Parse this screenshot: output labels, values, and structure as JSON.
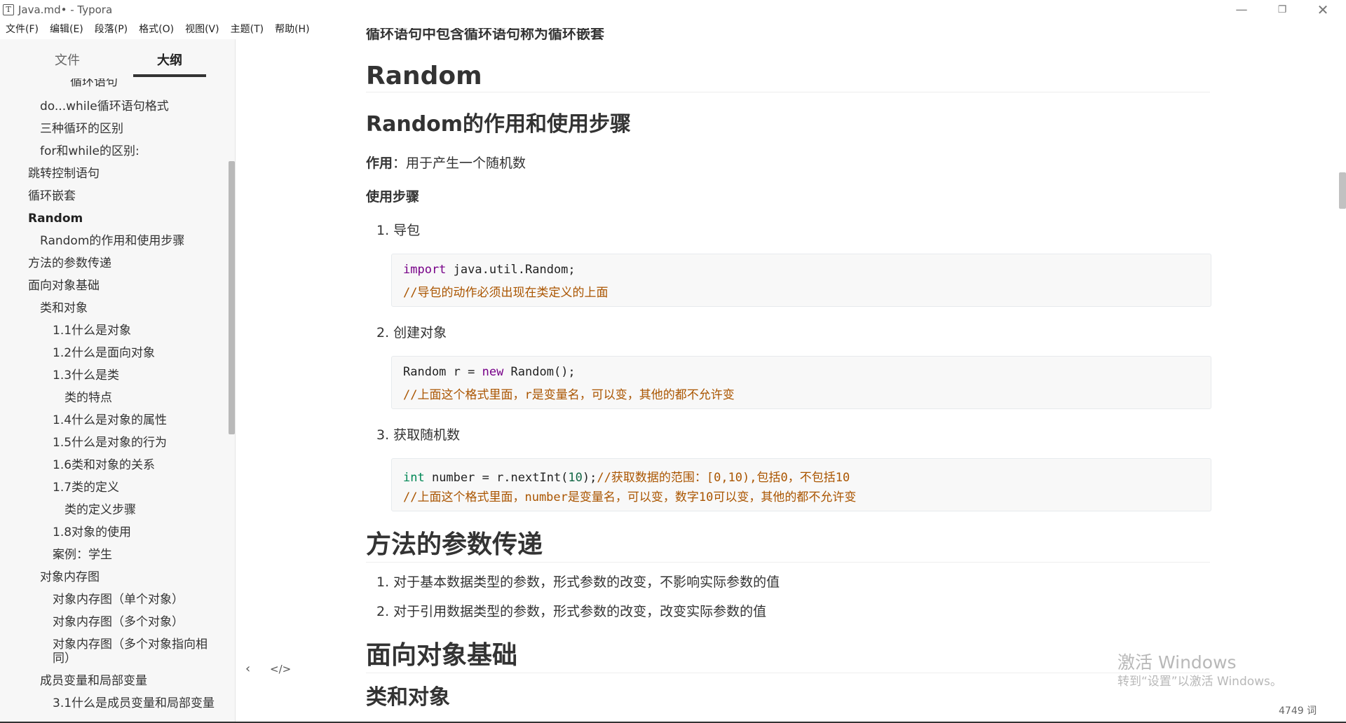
{
  "window": {
    "title": "Java.md• - Typora",
    "app_icon": "T",
    "controls": [
      "—",
      "❐",
      "✕"
    ]
  },
  "menu": [
    "文件(F)",
    "编辑(E)",
    "段落(P)",
    "格式(O)",
    "视图(V)",
    "主题(T)",
    "帮助(H)"
  ],
  "sidebar": {
    "tab_files": "文件",
    "tab_outline": "大纲",
    "cut_item": "循环语句",
    "outline": [
      {
        "text": "do...while循环语句格式",
        "level": 2
      },
      {
        "text": "三种循环的区别",
        "level": 2
      },
      {
        "text": "for和while的区别:",
        "level": 2
      },
      {
        "text": "跳转控制语句",
        "level": 1
      },
      {
        "text": "循环嵌套",
        "level": 1
      },
      {
        "text": "Random",
        "level": 1,
        "active": true
      },
      {
        "text": "Random的作用和使用步骤",
        "level": 2
      },
      {
        "text": "方法的参数传递",
        "level": 1
      },
      {
        "text": "面向对象基础",
        "level": 1
      },
      {
        "text": "类和对象",
        "level": 2
      },
      {
        "text": "1.1什么是对象",
        "level": 3
      },
      {
        "text": "1.2什么是面向对象",
        "level": 3
      },
      {
        "text": "1.3什么是类",
        "level": 3
      },
      {
        "text": "类的特点",
        "level": 4
      },
      {
        "text": "1.4什么是对象的属性",
        "level": 3
      },
      {
        "text": "1.5什么是对象的行为",
        "level": 3
      },
      {
        "text": "1.6类和对象的关系",
        "level": 3
      },
      {
        "text": "1.7类的定义",
        "level": 3
      },
      {
        "text": "类的定义步骤",
        "level": 4
      },
      {
        "text": "1.8对象的使用",
        "level": 3
      },
      {
        "text": "案例：学生",
        "level": 3
      },
      {
        "text": "对象内存图",
        "level": 2
      },
      {
        "text": "对象内存图（单个对象）",
        "level": 3
      },
      {
        "text": "对象内存图（多个对象）",
        "level": 3
      },
      {
        "text": "对象内存图（多个对象指向相同）",
        "level": 3
      },
      {
        "text": "成员变量和局部变量",
        "level": 2
      },
      {
        "text": "3.1什么是成员变量和局部变量",
        "level": 3
      }
    ],
    "btn_prev": "‹",
    "btn_code": "</>"
  },
  "content": {
    "cut_line": "循环语句中包含循环语句称为循环嵌套",
    "h1_random": "Random",
    "h2_random_usage": "Random的作用和使用步骤",
    "purpose_label": "作用",
    "purpose_text": "：用于产生一个随机数",
    "steps_label": "使用步骤",
    "step1": "1. 导包",
    "code1": {
      "l1_kw": "import",
      "l1_rest": " java.util.Random;",
      "l2": "//导包的动作必须出现在类定义的上面"
    },
    "step2": "2. 创建对象",
    "code2": {
      "l1_a": "Random r = ",
      "l1_kw": "new",
      "l1_b": " Random();",
      "l2": "//上面这个格式里面，r是变量名，可以变，其他的都不允许变"
    },
    "step3": "3. 获取随机数",
    "code3": {
      "l1_ty": "int",
      "l1_a": " number = r.nextInt(",
      "l1_num": "10",
      "l1_b": ");",
      "l1_cm": "//获取数据的范围：[0,10),包括0，不包括10",
      "l2": "//上面这个格式里面，number是变量名，可以变，数字10可以变，其他的都不允许变"
    },
    "h1_params": "方法的参数传递",
    "param1": "1. 对于基本数据类型的参数，形式参数的改变，不影响实际参数的值",
    "param2": "2. 对于引用数据类型的参数，形式参数的改变，改变实际参数的值",
    "h1_oop": "面向对象基础",
    "h2_class": "类和对象"
  },
  "watermark": {
    "line1": "激活 Windows",
    "line2": "转到“设置”以激活 Windows。"
  },
  "status": {
    "word_count": "4749 词"
  }
}
